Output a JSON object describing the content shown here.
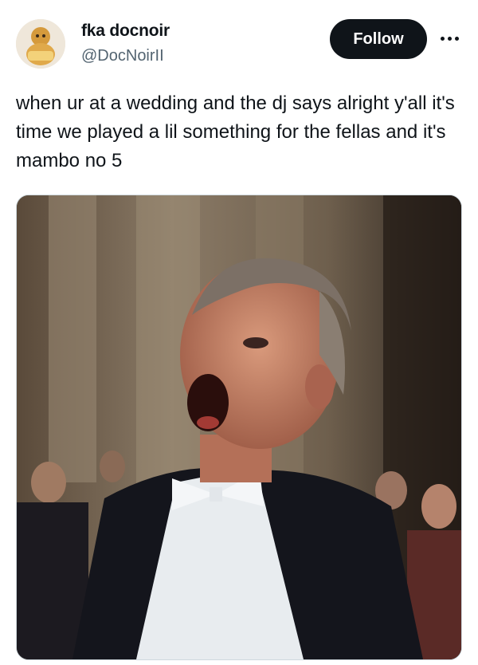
{
  "author": {
    "display_name": "fka docnoir",
    "handle": "@DocNoirII",
    "avatar_icon": "avatar-image"
  },
  "actions": {
    "follow_label": "Follow",
    "more_icon": "more-horizontal-icon"
  },
  "tweet": {
    "text": "when ur at a wedding and the dj says alright y'all it's time we played a lil something for the fellas and it's mambo no 5"
  },
  "media": {
    "type": "photo"
  },
  "colors": {
    "text_primary": "#0f1419",
    "text_secondary": "#536471",
    "button_bg": "#0f1419",
    "border": "#cfd9de"
  }
}
